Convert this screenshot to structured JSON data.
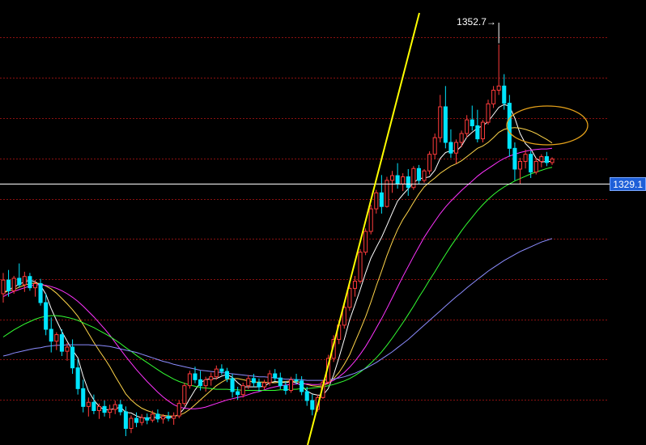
{
  "chart_data": {
    "type": "candlestick",
    "title": "",
    "background": "#000000",
    "ylim": [
      1285,
      1360
    ],
    "grid": true,
    "gridlines": [
      1292.6,
      1299.4,
      1306.2,
      1313.0,
      1319.8,
      1326.5,
      1333.3,
      1340.1,
      1346.9,
      1353.7
    ],
    "colors": {
      "up": "#ff3b3b",
      "down": "#00e5ff",
      "grid": "#8a1010",
      "price_line": "#ffffff",
      "trendline": "#ffff00",
      "ellipse": "#e6a21a"
    },
    "candles": [
      [
        1310.5,
        1314.0,
        1309.0,
        1312.8
      ],
      [
        1312.8,
        1314.5,
        1310.0,
        1311.0
      ],
      [
        1311.0,
        1313.5,
        1310.5,
        1313.1
      ],
      [
        1313.1,
        1315.6,
        1311.5,
        1312.0
      ],
      [
        1312.0,
        1314.2,
        1310.8,
        1313.4
      ],
      [
        1313.4,
        1314.0,
        1311.0,
        1311.5
      ],
      [
        1311.5,
        1312.8,
        1310.0,
        1312.2
      ],
      [
        1312.2,
        1313.0,
        1308.5,
        1309.0
      ],
      [
        1309.0,
        1310.5,
        1303.5,
        1304.5
      ],
      [
        1304.5,
        1306.5,
        1300.6,
        1302.5
      ],
      [
        1302.5,
        1304.0,
        1301.0,
        1303.6
      ],
      [
        1303.6,
        1304.5,
        1300.0,
        1300.8
      ],
      [
        1300.8,
        1302.2,
        1299.2,
        1301.5
      ],
      [
        1301.5,
        1302.8,
        1297.0,
        1298.0
      ],
      [
        1298.0,
        1299.5,
        1293.5,
        1294.5
      ],
      [
        1294.5,
        1296.0,
        1290.5,
        1291.5
      ],
      [
        1291.5,
        1293.0,
        1289.8,
        1292.2
      ],
      [
        1292.2,
        1293.5,
        1290.2,
        1290.8
      ],
      [
        1290.8,
        1292.0,
        1289.4,
        1291.5
      ],
      [
        1291.5,
        1292.5,
        1289.8,
        1290.5
      ],
      [
        1290.5,
        1291.8,
        1289.5,
        1291.0
      ],
      [
        1291.0,
        1292.5,
        1290.2,
        1291.8
      ],
      [
        1291.8,
        1292.6,
        1290.0,
        1290.6
      ],
      [
        1290.6,
        1291.5,
        1286.5,
        1287.8
      ],
      [
        1287.8,
        1290.0,
        1287.0,
        1289.5
      ],
      [
        1289.5,
        1290.5,
        1288.0,
        1288.8
      ],
      [
        1288.8,
        1290.2,
        1288.3,
        1289.6
      ],
      [
        1289.6,
        1290.3,
        1288.5,
        1289.2
      ],
      [
        1289.2,
        1290.8,
        1288.8,
        1290.2
      ],
      [
        1290.2,
        1291.0,
        1288.8,
        1289.4
      ],
      [
        1289.4,
        1290.2,
        1288.6,
        1289.8
      ],
      [
        1289.8,
        1290.6,
        1289.0,
        1289.5
      ],
      [
        1289.5,
        1290.5,
        1288.4,
        1289.9
      ],
      [
        1289.9,
        1292.5,
        1289.5,
        1292.0
      ],
      [
        1292.0,
        1295.5,
        1291.6,
        1295.0
      ],
      [
        1295.0,
        1297.5,
        1294.5,
        1297.0
      ],
      [
        1297.0,
        1298.2,
        1295.4,
        1296.0
      ],
      [
        1296.0,
        1297.5,
        1294.2,
        1295.0
      ],
      [
        1295.0,
        1296.5,
        1294.0,
        1296.0
      ],
      [
        1296.0,
        1297.2,
        1295.0,
        1296.5
      ],
      [
        1296.5,
        1298.4,
        1296.0,
        1297.8
      ],
      [
        1297.8,
        1298.6,
        1296.8,
        1297.4
      ],
      [
        1297.4,
        1298.0,
        1295.6,
        1296.2
      ],
      [
        1296.2,
        1297.0,
        1293.0,
        1294.0
      ],
      [
        1294.0,
        1294.8,
        1292.6,
        1293.5
      ],
      [
        1293.5,
        1295.5,
        1293.0,
        1295.0
      ],
      [
        1295.0,
        1296.8,
        1294.4,
        1296.2
      ],
      [
        1296.2,
        1297.0,
        1294.8,
        1295.5
      ],
      [
        1295.5,
        1296.2,
        1294.0,
        1294.8
      ],
      [
        1294.8,
        1296.0,
        1294.4,
        1295.5
      ],
      [
        1295.5,
        1297.6,
        1295.0,
        1297.0
      ],
      [
        1297.0,
        1297.8,
        1295.8,
        1296.3
      ],
      [
        1296.3,
        1297.2,
        1294.4,
        1295.0
      ],
      [
        1295.0,
        1295.8,
        1293.5,
        1294.2
      ],
      [
        1294.2,
        1296.5,
        1293.8,
        1296.0
      ],
      [
        1296.0,
        1297.0,
        1295.2,
        1295.8
      ],
      [
        1295.8,
        1296.6,
        1293.4,
        1294.0
      ],
      [
        1294.0,
        1294.8,
        1291.6,
        1292.5
      ],
      [
        1292.5,
        1293.5,
        1290.0,
        1291.0
      ],
      [
        1291.0,
        1293.5,
        1290.6,
        1293.0
      ],
      [
        1293.0,
        1296.0,
        1292.8,
        1295.6
      ],
      [
        1295.6,
        1300.2,
        1295.2,
        1299.6
      ],
      [
        1299.6,
        1303.5,
        1299.0,
        1302.8
      ],
      [
        1302.8,
        1306.0,
        1302.0,
        1305.2
      ],
      [
        1305.2,
        1309.0,
        1304.6,
        1308.2
      ],
      [
        1308.2,
        1312.0,
        1307.6,
        1311.4
      ],
      [
        1311.4,
        1313.5,
        1310.0,
        1312.6
      ],
      [
        1312.6,
        1318.0,
        1312.2,
        1317.5
      ],
      [
        1317.5,
        1321.5,
        1317.0,
        1321.0
      ],
      [
        1321.0,
        1325.5,
        1320.5,
        1324.8
      ],
      [
        1324.8,
        1328.0,
        1324.0,
        1327.5
      ],
      [
        1327.5,
        1330.5,
        1324.0,
        1325.2
      ],
      [
        1325.2,
        1330.2,
        1325.0,
        1329.6
      ],
      [
        1329.6,
        1331.2,
        1327.5,
        1330.4
      ],
      [
        1330.4,
        1332.5,
        1328.2,
        1329.0
      ],
      [
        1329.0,
        1330.8,
        1327.8,
        1330.2
      ],
      [
        1330.2,
        1331.5,
        1327.0,
        1328.4
      ],
      [
        1328.4,
        1332.0,
        1328.0,
        1331.6
      ],
      [
        1331.6,
        1332.2,
        1329.0,
        1329.6
      ],
      [
        1329.6,
        1331.5,
        1329.2,
        1331.2
      ],
      [
        1331.2,
        1334.5,
        1330.6,
        1334.0
      ],
      [
        1334.0,
        1337.5,
        1333.2,
        1336.8
      ],
      [
        1336.8,
        1344.0,
        1336.0,
        1342.0
      ],
      [
        1342.0,
        1345.5,
        1335.0,
        1336.0
      ],
      [
        1336.0,
        1338.2,
        1333.4,
        1334.2
      ],
      [
        1334.2,
        1336.5,
        1332.4,
        1336.0
      ],
      [
        1336.0,
        1338.0,
        1335.2,
        1337.5
      ],
      [
        1337.5,
        1340.6,
        1336.8,
        1339.8
      ],
      [
        1339.8,
        1342.2,
        1338.0,
        1338.8
      ],
      [
        1338.8,
        1341.5,
        1336.0,
        1336.6
      ],
      [
        1336.6,
        1339.8,
        1336.0,
        1339.4
      ],
      [
        1339.4,
        1343.2,
        1339.0,
        1342.5
      ],
      [
        1342.5,
        1345.5,
        1341.8,
        1344.8
      ],
      [
        1344.8,
        1352.5,
        1344.0,
        1345.5
      ],
      [
        1345.5,
        1347.5,
        1341.5,
        1342.6
      ],
      [
        1342.6,
        1344.0,
        1333.6,
        1335.0
      ],
      [
        1335.0,
        1336.0,
        1329.6,
        1331.5
      ],
      [
        1331.5,
        1333.4,
        1329.0,
        1332.8
      ],
      [
        1332.8,
        1334.8,
        1331.6,
        1334.0
      ],
      [
        1334.0,
        1334.6,
        1330.0,
        1331.0
      ],
      [
        1331.0,
        1333.4,
        1330.6,
        1332.8
      ],
      [
        1332.8,
        1334.0,
        1331.8,
        1333.6
      ],
      [
        1333.6,
        1334.4,
        1332.0,
        1332.6
      ],
      [
        1332.6,
        1333.5,
        1332.2,
        1333.2
      ]
    ],
    "moving_averages": [
      {
        "color": "#ffffff",
        "values": [
          1310.6,
          1311.2,
          1311.6,
          1312.1,
          1312.5,
          1312.8,
          1312.5,
          1311.9,
          1310.4,
          1308.0,
          1306.0,
          1304.1,
          1302.5,
          1301.0,
          1299.7,
          1296.6,
          1294.1,
          1292.6,
          1291.5,
          1290.9,
          1291.0,
          1291.1,
          1291.4,
          1290.5,
          1290.4,
          1289.9,
          1289.6,
          1289.5,
          1289.6,
          1289.7,
          1289.7,
          1289.7,
          1289.7,
          1290.2,
          1291.2,
          1292.8,
          1294.3,
          1295.5,
          1296.0,
          1296.2,
          1296.2,
          1296.6,
          1296.9,
          1296.4,
          1295.5,
          1294.8,
          1294.8,
          1294.8,
          1294.8,
          1294.9,
          1295.5,
          1295.7,
          1295.6,
          1295.5,
          1295.7,
          1295.5,
          1295.0,
          1294.1,
          1293.6,
          1293.4,
          1293.4,
          1294.5,
          1296.8,
          1299.7,
          1302.8,
          1306.1,
          1308.6,
          1311.2,
          1314.0,
          1316.5,
          1318.3,
          1320.0,
          1322.0,
          1324.1,
          1326.1,
          1327.2,
          1328.2,
          1329.2,
          1329.9,
          1330.0,
          1330.2,
          1331.3,
          1333.3,
          1334.3,
          1334.6,
          1334.5,
          1335.4,
          1336.9,
          1337.7,
          1338.4,
          1338.8,
          1339.5,
          1340.7,
          1341.9,
          1342.4,
          1342.1,
          1340.1,
          1337.5,
          1335.8,
          1334.9,
          1333.3,
          1332.7,
          1332.8,
          1332.8
        ]
      },
      {
        "color": "#ffd54a",
        "values": [
          1310.6,
          1311.0,
          1311.2,
          1311.6,
          1311.9,
          1312.2,
          1312.3,
          1312.2,
          1311.8,
          1311.3,
          1310.6,
          1309.7,
          1308.8,
          1307.8,
          1306.7,
          1305.3,
          1303.8,
          1302.3,
          1300.9,
          1299.6,
          1298.2,
          1296.6,
          1295.1,
          1293.6,
          1292.6,
          1291.8,
          1291.2,
          1290.8,
          1290.5,
          1290.1,
          1290.0,
          1289.9,
          1289.9,
          1290.0,
          1290.4,
          1291.0,
          1291.8,
          1292.6,
          1293.4,
          1294.2,
          1295.0,
          1295.6,
          1296.1,
          1296.2,
          1296.2,
          1296.0,
          1295.8,
          1295.6,
          1295.6,
          1295.6,
          1295.5,
          1295.5,
          1295.6,
          1295.7,
          1295.8,
          1295.7,
          1295.5,
          1295.2,
          1295.0,
          1294.9,
          1295.0,
          1295.4,
          1296.2,
          1297.2,
          1298.6,
          1300.2,
          1302.3,
          1304.4,
          1306.6,
          1309.1,
          1311.8,
          1314.3,
          1316.9,
          1319.2,
          1321.3,
          1323.0,
          1324.4,
          1325.9,
          1327.3,
          1328.5,
          1329.3,
          1330.0,
          1330.8,
          1331.4,
          1332.0,
          1332.4,
          1332.9,
          1333.6,
          1334.3,
          1335.0,
          1335.4,
          1336.0,
          1336.8,
          1337.7,
          1338.2,
          1338.4,
          1338.5,
          1338.4,
          1338.2,
          1337.9,
          1337.5,
          1337.0,
          1336.5,
          1335.9
        ]
      },
      {
        "color": "#ff33ff",
        "values": [
          1310.0,
          1310.5,
          1310.9,
          1311.2,
          1311.5,
          1311.8,
          1312.0,
          1312.0,
          1311.9,
          1311.7,
          1311.4,
          1311.0,
          1310.5,
          1309.9,
          1309.2,
          1308.4,
          1307.5,
          1306.6,
          1305.6,
          1304.6,
          1303.5,
          1302.3,
          1301.1,
          1299.9,
          1298.8,
          1297.7,
          1296.7,
          1295.7,
          1294.8,
          1293.9,
          1293.1,
          1292.4,
          1291.8,
          1291.4,
          1291.2,
          1291.1,
          1291.1,
          1291.2,
          1291.4,
          1291.7,
          1292.0,
          1292.3,
          1292.6,
          1292.8,
          1293.0,
          1293.2,
          1293.5,
          1293.8,
          1294.0,
          1294.3,
          1294.6,
          1294.8,
          1295.0,
          1295.1,
          1295.2,
          1295.3,
          1295.3,
          1295.3,
          1295.2,
          1295.2,
          1295.3,
          1295.5,
          1295.9,
          1296.5,
          1297.2,
          1298.1,
          1299.1,
          1300.3,
          1301.6,
          1303.1,
          1304.7,
          1306.3,
          1308.0,
          1309.8,
          1311.6,
          1313.4,
          1315.1,
          1316.8,
          1318.4,
          1320.0,
          1321.4,
          1322.7,
          1324.0,
          1325.1,
          1326.1,
          1327.0,
          1327.9,
          1328.7,
          1329.5,
          1330.3,
          1331.0,
          1331.6,
          1332.2,
          1332.8,
          1333.3,
          1333.7,
          1334.0,
          1334.3,
          1334.5,
          1334.7,
          1334.8,
          1334.9,
          1334.9,
          1335.0
        ]
      },
      {
        "color": "#33ff33",
        "values": [
          1303.2,
          1303.8,
          1304.4,
          1304.9,
          1305.4,
          1305.8,
          1306.2,
          1306.5,
          1306.7,
          1306.8,
          1306.8,
          1306.7,
          1306.5,
          1306.3,
          1306.0,
          1305.6,
          1305.2,
          1304.8,
          1304.3,
          1303.8,
          1303.3,
          1302.7,
          1302.1,
          1301.4,
          1300.8,
          1300.1,
          1299.5,
          1298.9,
          1298.3,
          1297.7,
          1297.1,
          1296.6,
          1296.1,
          1295.7,
          1295.4,
          1295.1,
          1294.9,
          1294.7,
          1294.6,
          1294.5,
          1294.4,
          1294.4,
          1294.4,
          1294.3,
          1294.3,
          1294.2,
          1294.2,
          1294.2,
          1294.2,
          1294.2,
          1294.2,
          1294.2,
          1294.3,
          1294.3,
          1294.4,
          1294.4,
          1294.5,
          1294.5,
          1294.6,
          1294.7,
          1294.8,
          1295.0,
          1295.2,
          1295.5,
          1295.8,
          1296.2,
          1296.7,
          1297.3,
          1298.0,
          1298.8,
          1299.7,
          1300.7,
          1301.8,
          1303.0,
          1304.3,
          1305.6,
          1307.0,
          1308.4,
          1309.9,
          1311.3,
          1312.8,
          1314.2,
          1315.7,
          1317.1,
          1318.5,
          1319.8,
          1321.1,
          1322.3,
          1323.4,
          1324.5,
          1325.5,
          1326.4,
          1327.2,
          1327.9,
          1328.5,
          1329.0,
          1329.5,
          1329.9,
          1330.3,
          1330.7,
          1331.0,
          1331.3,
          1331.6,
          1331.8
        ]
      },
      {
        "color": "#8c8cff",
        "values": [
          1300.0,
          1300.2,
          1300.5,
          1300.7,
          1300.9,
          1301.1,
          1301.3,
          1301.4,
          1301.6,
          1301.7,
          1301.8,
          1301.8,
          1301.9,
          1301.9,
          1301.9,
          1301.9,
          1301.9,
          1301.8,
          1301.8,
          1301.7,
          1301.6,
          1301.4,
          1301.2,
          1301.0,
          1300.8,
          1300.6,
          1300.3,
          1300.0,
          1299.7,
          1299.4,
          1299.1,
          1298.9,
          1298.6,
          1298.4,
          1298.2,
          1298.0,
          1297.8,
          1297.6,
          1297.5,
          1297.4,
          1297.3,
          1297.2,
          1297.1,
          1297.0,
          1296.9,
          1296.8,
          1296.7,
          1296.6,
          1296.5,
          1296.5,
          1296.4,
          1296.3,
          1296.2,
          1296.1,
          1296.1,
          1296.0,
          1296.0,
          1295.9,
          1295.9,
          1295.9,
          1295.9,
          1296.0,
          1296.1,
          1296.3,
          1296.5,
          1296.8,
          1297.1,
          1297.5,
          1297.9,
          1298.4,
          1298.9,
          1299.5,
          1300.1,
          1300.7,
          1301.4,
          1302.1,
          1302.8,
          1303.6,
          1304.4,
          1305.2,
          1306.0,
          1306.8,
          1307.6,
          1308.4,
          1309.2,
          1310.0,
          1310.7,
          1311.5,
          1312.2,
          1312.9,
          1313.6,
          1314.3,
          1314.9,
          1315.5,
          1316.1,
          1316.6,
          1317.1,
          1317.6,
          1318.0,
          1318.4,
          1318.8,
          1319.2,
          1319.5,
          1319.8
        ]
      }
    ],
    "current_price": 1329.1,
    "high_label": "1352.7→",
    "high_price": 1352.7,
    "high_index": 93
  }
}
